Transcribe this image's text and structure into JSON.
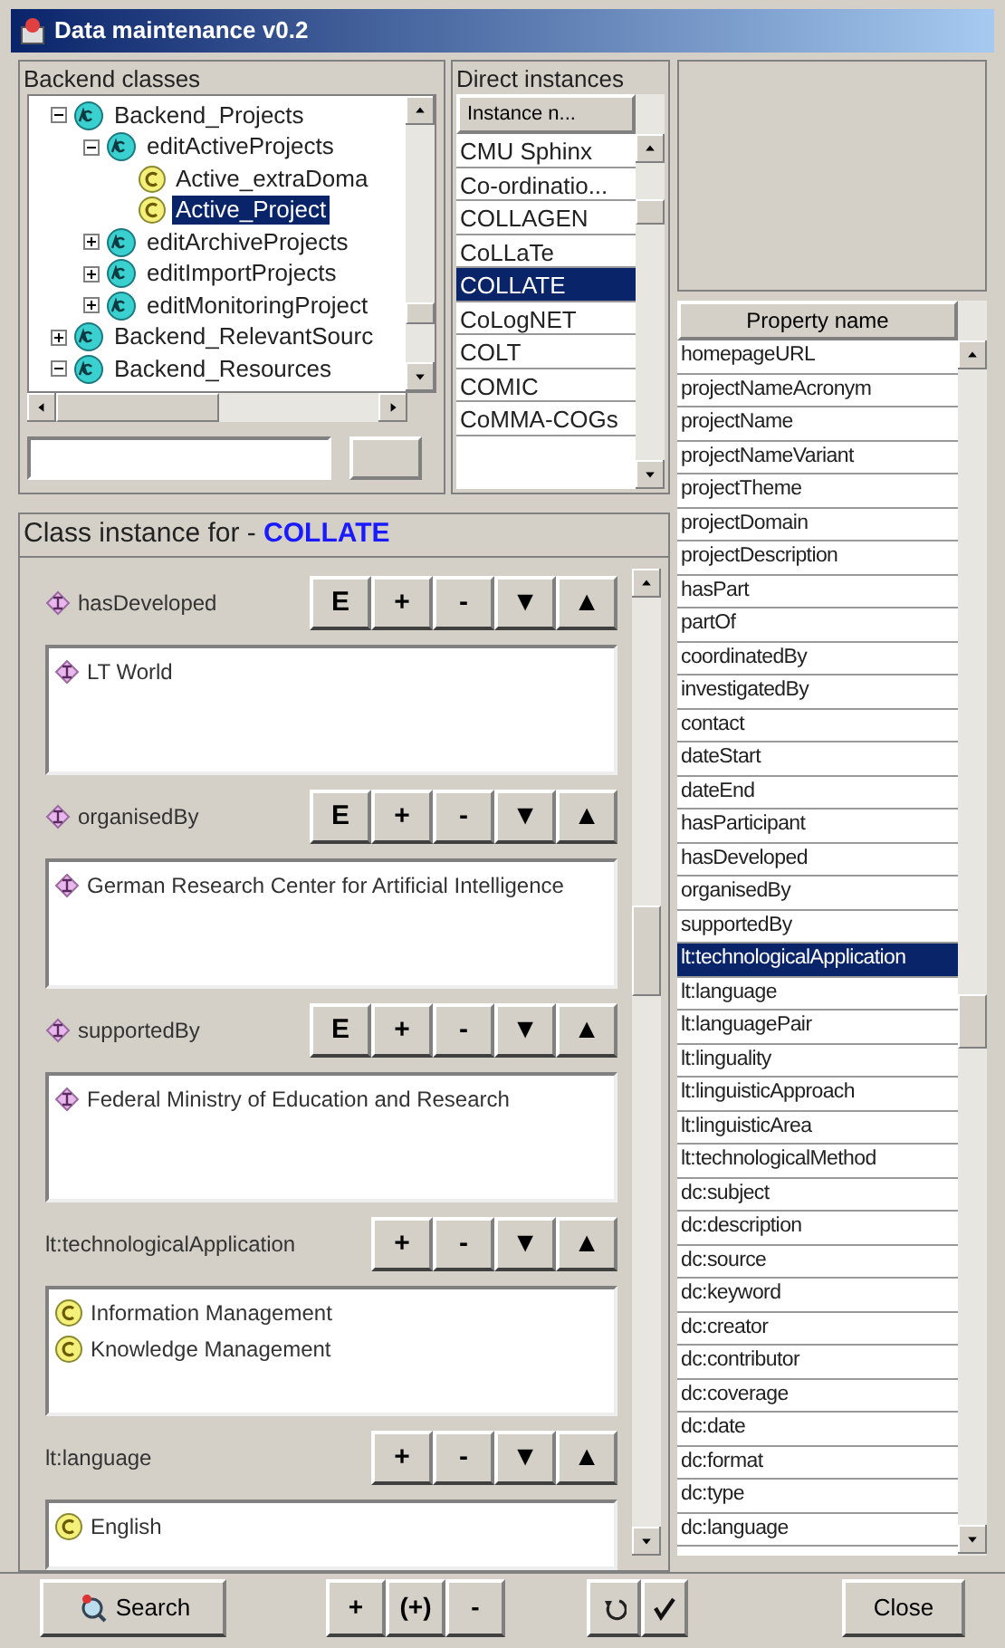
{
  "window": {
    "title": "Data maintenance v0.2"
  },
  "backend_classes": {
    "title": "Backend classes",
    "tree": [
      {
        "label": "Backend_Projects",
        "kind": "metaclass",
        "expanded": true,
        "selected": false,
        "children": [
          {
            "label": "editActiveProjects",
            "kind": "metaclass",
            "expanded": true,
            "selected": false,
            "children": [
              {
                "label": "Active_extraDoma",
                "kind": "class",
                "selected": false
              },
              {
                "label": "Active_Project",
                "kind": "class",
                "selected": true
              }
            ]
          },
          {
            "label": "editArchiveProjects",
            "kind": "metaclass",
            "expanded": false,
            "selected": false
          },
          {
            "label": "editImportProjects",
            "kind": "metaclass",
            "expanded": false,
            "selected": false
          },
          {
            "label": "editMonitoringProject",
            "kind": "metaclass",
            "expanded": false,
            "selected": false
          }
        ]
      },
      {
        "label": "Backend_RelevantSourc",
        "kind": "metaclass",
        "expanded": false,
        "selected": false
      },
      {
        "label": "Backend_Resources",
        "kind": "metaclass",
        "expanded": true,
        "selected": false
      }
    ]
  },
  "direct_instances": {
    "title": "Direct instances",
    "column": "Instance n...",
    "rows": [
      {
        "label": "CMU Sphinx",
        "selected": false
      },
      {
        "label": "Co-ordinatio...",
        "selected": false
      },
      {
        "label": "COLLAGEN",
        "selected": false
      },
      {
        "label": "CoLLaTe",
        "selected": false
      },
      {
        "label": "COLLATE",
        "selected": true
      },
      {
        "label": "CoLogNET",
        "selected": false
      },
      {
        "label": "COLT",
        "selected": false
      },
      {
        "label": "COMIC",
        "selected": false
      },
      {
        "label": "CoMMA-COGs",
        "selected": false
      }
    ]
  },
  "class_instance": {
    "title": "Class instance for - ",
    "instance": "COLLATE",
    "slots": [
      {
        "name": "hasDeveloped",
        "kind": "instance",
        "buttons": [
          "E",
          "+",
          "-",
          "▼",
          "▲"
        ],
        "values": [
          {
            "label": "LT World",
            "kind": "instance"
          }
        ]
      },
      {
        "name": "organisedBy",
        "kind": "instance",
        "buttons": [
          "E",
          "+",
          "-",
          "▼",
          "▲"
        ],
        "values": [
          {
            "label": "German Research Center for Artificial Intelligence",
            "kind": "instance"
          }
        ]
      },
      {
        "name": "supportedBy",
        "kind": "instance",
        "buttons": [
          "E",
          "+",
          "-",
          "▼",
          "▲"
        ],
        "values": [
          {
            "label": "Federal Ministry of Education and Research",
            "kind": "instance"
          }
        ]
      },
      {
        "name": "lt:technologicalApplication",
        "kind": "class",
        "buttons": [
          "+",
          "-",
          "▼",
          "▲"
        ],
        "values": [
          {
            "label": "Information Management",
            "kind": "class"
          },
          {
            "label": "Knowledge Management",
            "kind": "class"
          }
        ]
      },
      {
        "name": "lt:language",
        "kind": "class",
        "buttons": [
          "+",
          "-",
          "▼",
          "▲"
        ],
        "values": [
          {
            "label": "English",
            "kind": "class"
          }
        ]
      }
    ]
  },
  "properties": {
    "column": "Property name",
    "rows": [
      {
        "label": "homepageURL",
        "selected": false
      },
      {
        "label": "projectNameAcronym",
        "selected": false
      },
      {
        "label": "projectName",
        "selected": false
      },
      {
        "label": "projectNameVariant",
        "selected": false
      },
      {
        "label": "projectTheme",
        "selected": false
      },
      {
        "label": "projectDomain",
        "selected": false
      },
      {
        "label": "projectDescription",
        "selected": false
      },
      {
        "label": "hasPart",
        "selected": false
      },
      {
        "label": "partOf",
        "selected": false
      },
      {
        "label": "coordinatedBy",
        "selected": false
      },
      {
        "label": "investigatedBy",
        "selected": false
      },
      {
        "label": "contact",
        "selected": false
      },
      {
        "label": "dateStart",
        "selected": false
      },
      {
        "label": "dateEnd",
        "selected": false
      },
      {
        "label": "hasParticipant",
        "selected": false
      },
      {
        "label": "hasDeveloped",
        "selected": false
      },
      {
        "label": "organisedBy",
        "selected": false
      },
      {
        "label": "supportedBy",
        "selected": false
      },
      {
        "label": "lt:technologicalApplication",
        "selected": true
      },
      {
        "label": "lt:language",
        "selected": false
      },
      {
        "label": "lt:languagePair",
        "selected": false
      },
      {
        "label": "lt:linguality",
        "selected": false
      },
      {
        "label": "lt:linguisticApproach",
        "selected": false
      },
      {
        "label": "lt:linguisticArea",
        "selected": false
      },
      {
        "label": "lt:technologicalMethod",
        "selected": false
      },
      {
        "label": "dc:subject",
        "selected": false
      },
      {
        "label": "dc:description",
        "selected": false
      },
      {
        "label": "dc:source",
        "selected": false
      },
      {
        "label": "dc:keyword",
        "selected": false
      },
      {
        "label": "dc:creator",
        "selected": false
      },
      {
        "label": "dc:contributor",
        "selected": false
      },
      {
        "label": "dc:coverage",
        "selected": false
      },
      {
        "label": "dc:date",
        "selected": false
      },
      {
        "label": "dc:format",
        "selected": false
      },
      {
        "label": "dc:type",
        "selected": false
      },
      {
        "label": "dc:language",
        "selected": false
      }
    ]
  },
  "bottom_bar": {
    "search": "Search",
    "instance_buttons": [
      "+",
      "(+)",
      "-"
    ],
    "close": "Close"
  }
}
